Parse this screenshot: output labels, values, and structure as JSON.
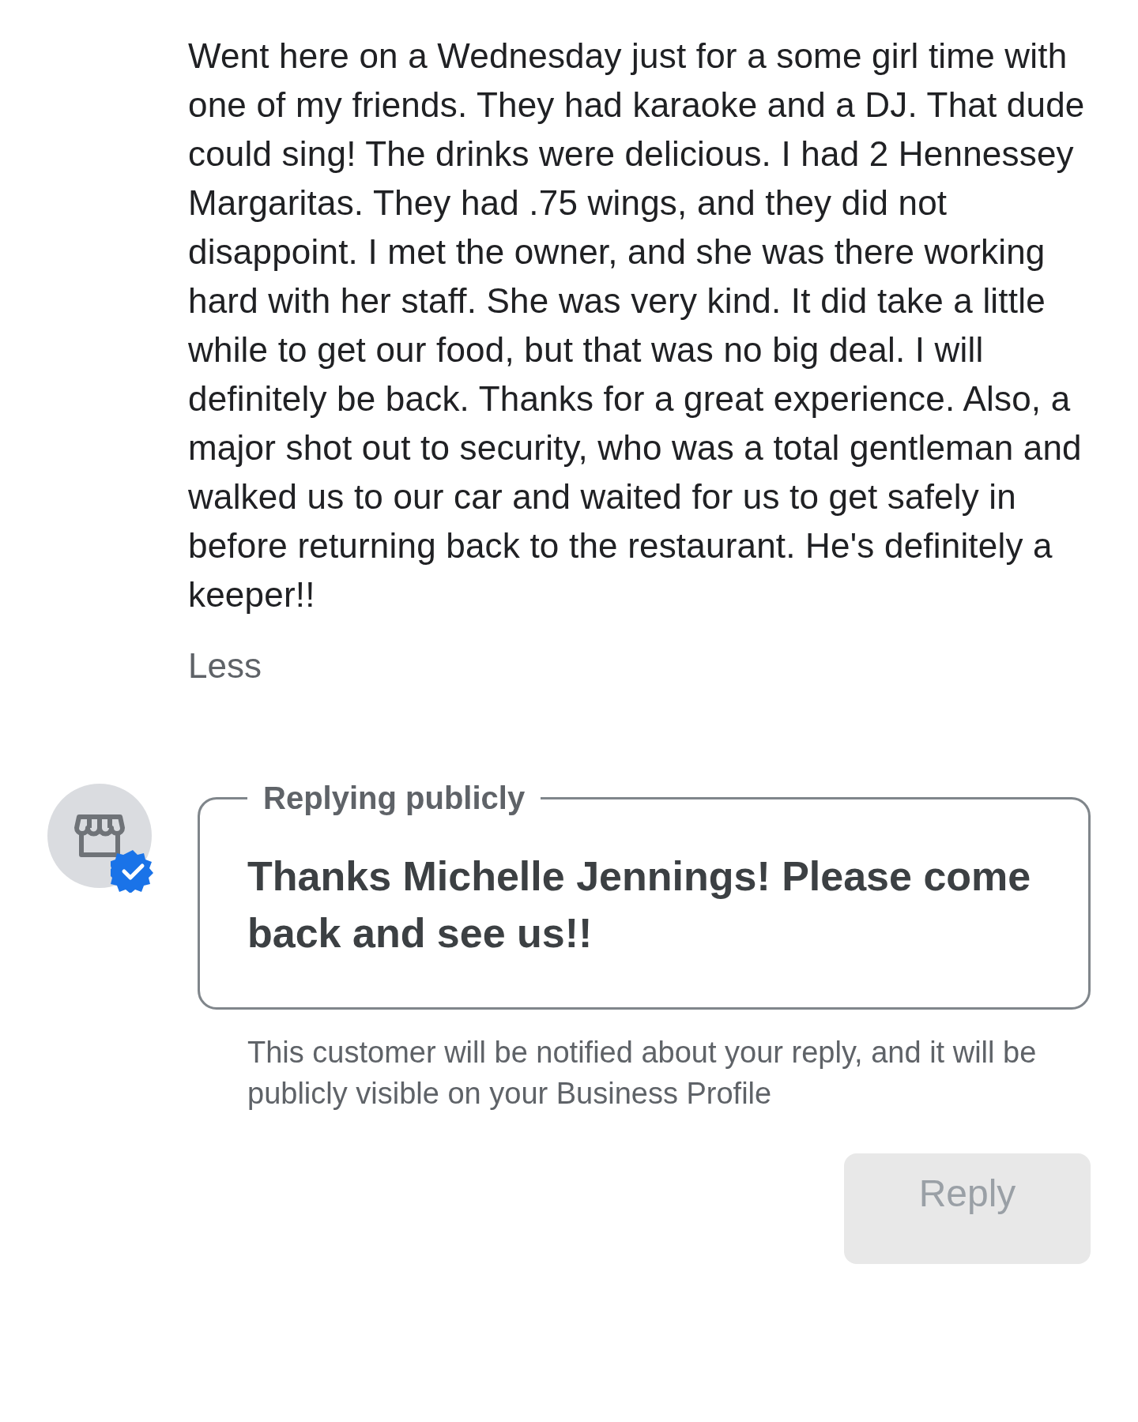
{
  "review": {
    "text": "Went here on a Wednesday just for a some girl time with one of my friends. They had karaoke and a DJ. That dude could sing! The drinks were delicious. I had 2 Hennessey Margaritas. They had .75 wings, and they did not disappoint. I met the owner, and she was there working hard with her staff. She was very kind. It did take a little while to get our food, but that was no big deal. I will definitely be back. Thanks for a great experience. Also, a major shot out to security, who was a total gentleman and walked us to our car and waited for us to get safely in before returning back to the restaurant. He's definitely a keeper!!",
    "less_link": "Less"
  },
  "reply": {
    "verified": true,
    "field_label": "Replying publicly",
    "value": "Thanks Michelle Jennings!  Please come back and see us!!",
    "helper": "This customer will be notified about your reply, and it will be publicly visible on your Business Profile",
    "button": {
      "label": "Reply",
      "disabled": true
    }
  }
}
